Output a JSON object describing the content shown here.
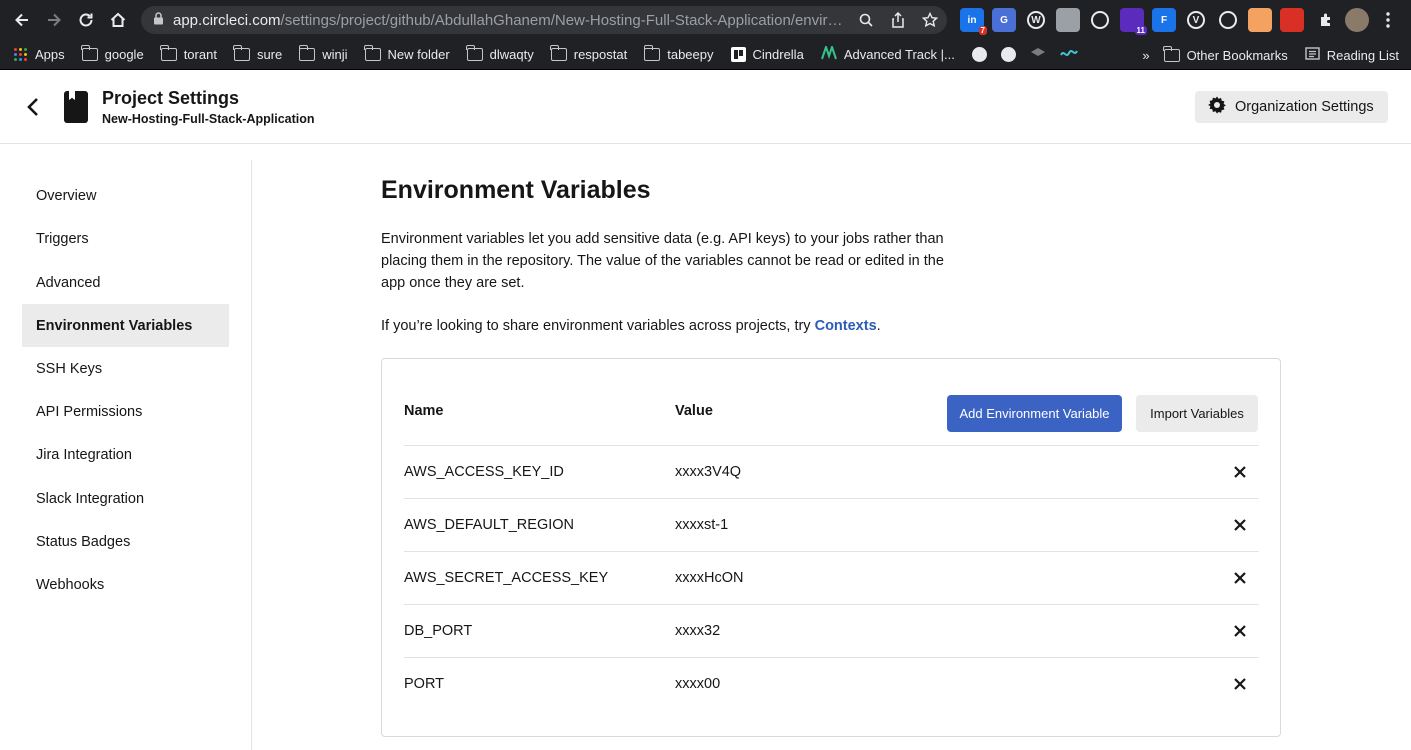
{
  "browser": {
    "url_host": "app.circleci.com",
    "url_path": "/settings/project/github/AbdullahGhanem/New-Hosting-Full-Stack-Application/envir…",
    "extensions": [
      {
        "icon": "ext-icon-1",
        "color": "#1a73e8",
        "label": "in",
        "badge": "7"
      },
      {
        "icon": "ext-icon-2",
        "color": "#4a6fd6",
        "label": "G",
        "badge": ""
      },
      {
        "icon": "ext-icon-3",
        "color": "#e8eaed",
        "label": "W",
        "badge": ""
      },
      {
        "icon": "ext-icon-4",
        "color": "#9aa0a6",
        "label": "",
        "badge": ""
      },
      {
        "icon": "ext-icon-5",
        "color": "#e8eaed",
        "label": "",
        "badge": ""
      },
      {
        "icon": "ext-icon-6",
        "color": "#5b2bbd",
        "label": "",
        "badge": "11"
      },
      {
        "icon": "ext-icon-7",
        "color": "#1a73e8",
        "label": "F",
        "badge": ""
      },
      {
        "icon": "ext-icon-8",
        "color": "#e8eaed",
        "label": "V",
        "badge": ""
      },
      {
        "icon": "ext-icon-9",
        "color": "#e8eaed",
        "label": "",
        "badge": ""
      },
      {
        "icon": "ext-icon-10",
        "color": "#f4a261",
        "label": "",
        "badge": ""
      },
      {
        "icon": "ext-icon-11",
        "color": "#d93025",
        "label": "",
        "badge": ""
      }
    ],
    "bookmarks": {
      "apps": "Apps",
      "folders": [
        "google",
        "torant",
        "sure",
        "winji",
        "New folder",
        "dlwaqty",
        "respostat",
        "tabeepy"
      ],
      "cindrella": "Cindrella",
      "advanced": "Advanced Track |...",
      "chevron": "»",
      "other": "Other Bookmarks",
      "reading": "Reading List"
    }
  },
  "header": {
    "title": "Project Settings",
    "project": "New-Hosting-Full-Stack-Application",
    "org_button": "Organization Settings"
  },
  "sidebar": {
    "items": [
      {
        "label": "Overview"
      },
      {
        "label": "Triggers"
      },
      {
        "label": "Advanced"
      },
      {
        "label": "Environment Variables",
        "active": true
      },
      {
        "label": "SSH Keys"
      },
      {
        "label": "API Permissions"
      },
      {
        "label": "Jira Integration"
      },
      {
        "label": "Slack Integration"
      },
      {
        "label": "Status Badges"
      },
      {
        "label": "Webhooks"
      }
    ]
  },
  "main": {
    "title": "Environment Variables",
    "description": "Environment variables let you add sensitive data (e.g. API keys) to your jobs rather than placing them in the repository. The value of the variables cannot be read or edited in the app once they are set.",
    "share_prefix": "If you’re looking to share environment variables across projects, try ",
    "share_link": "Contexts",
    "share_suffix": ".",
    "table": {
      "col_name": "Name",
      "col_value": "Value",
      "add_button": "Add Environment Variable",
      "import_button": "Import Variables",
      "rows": [
        {
          "name": "AWS_ACCESS_KEY_ID",
          "value": "xxxx3V4Q"
        },
        {
          "name": "AWS_DEFAULT_REGION",
          "value": "xxxxst-1"
        },
        {
          "name": "AWS_SECRET_ACCESS_KEY",
          "value": "xxxxHcON"
        },
        {
          "name": "DB_PORT",
          "value": "xxxx32"
        },
        {
          "name": "PORT",
          "value": "xxxx00"
        }
      ]
    }
  },
  "colors": {
    "primary_button": "#3b63c4",
    "link": "#2b5cb8",
    "active_nav_bg": "#ebebeb"
  }
}
